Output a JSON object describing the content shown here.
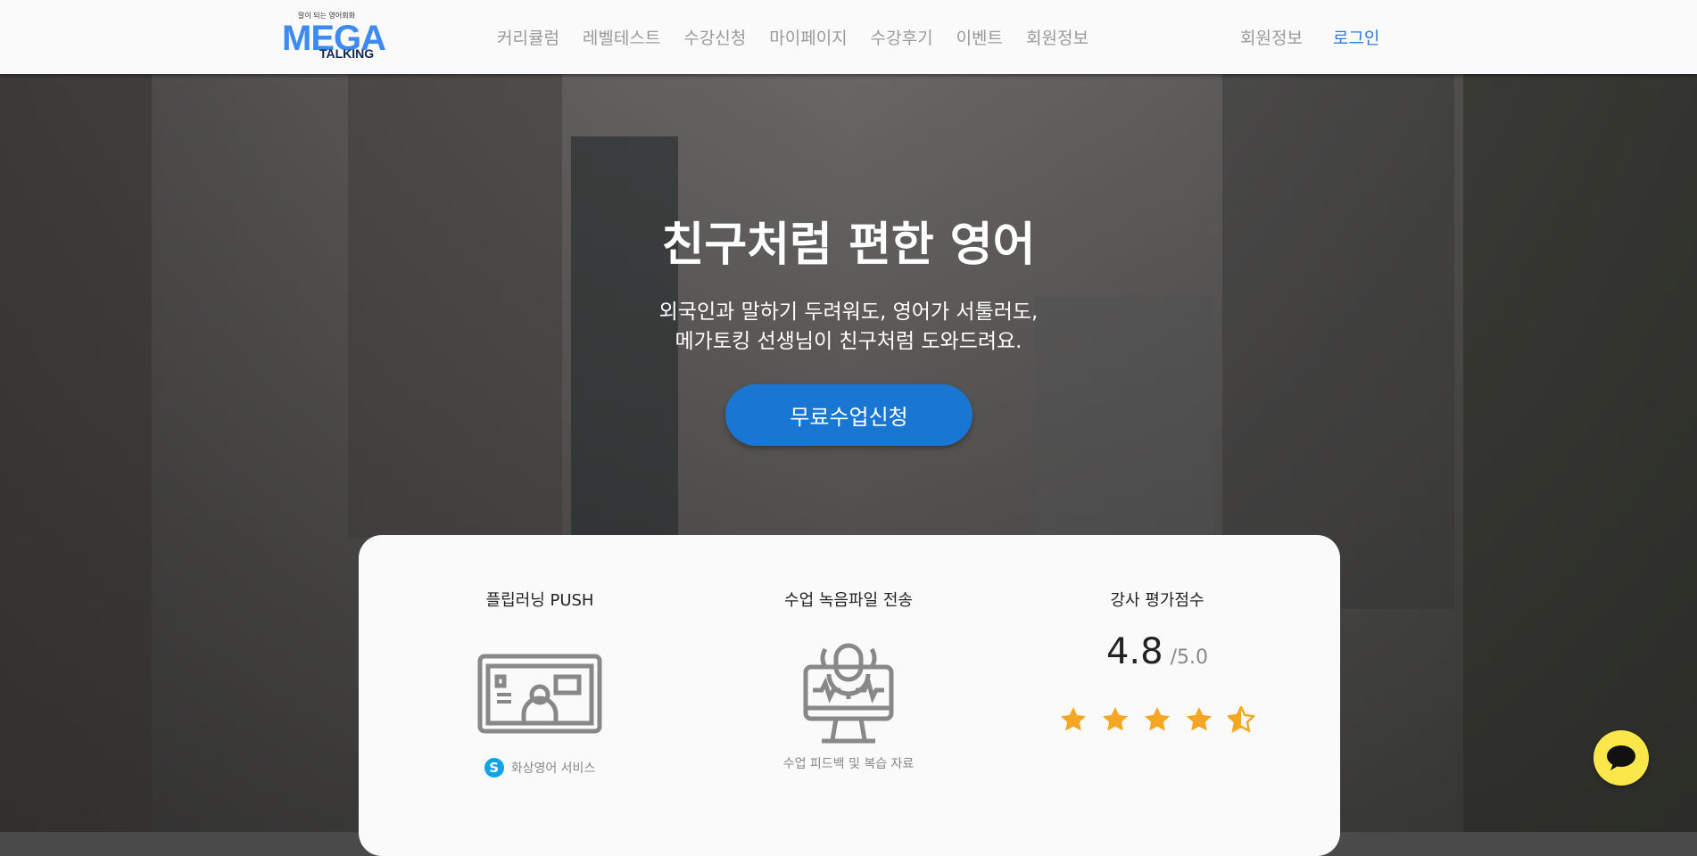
{
  "header": {
    "logo_tagline": "말이 되는 영어회화",
    "logo_text_top": "MEGA",
    "logo_text_bottom": "TALKING",
    "nav": [
      "커리큘럼",
      "레벨테스트",
      "수강신청",
      "마이페이지",
      "수강후기",
      "이벤트",
      "회원정보"
    ],
    "member_label": "회원정보",
    "login_label": "로그인"
  },
  "hero": {
    "title": "친구처럼 편한 영어",
    "subtitle_line1": "외국인과 말하기 두려워도, 영어가 서툴러도,",
    "subtitle_line2": "메가토킹 선생님이 친구처럼 도와드려요.",
    "cta_label": "무료수업신청"
  },
  "features": {
    "push": {
      "title": "플립러닝 PUSH",
      "caption": "화상영어 서비스",
      "icon": "video-call-icon",
      "caption_icon": "skype-icon"
    },
    "recording": {
      "title": "수업 녹음파일 전송",
      "caption": "수업 피드백 및 복습 자료",
      "icon": "microphone-monitor-icon"
    },
    "rating": {
      "title": "강사 평가점수",
      "score": "4.8",
      "max": "/5.0",
      "stars": 4.5
    }
  },
  "colors": {
    "accent": "#1a76d3",
    "star": "#f5a623",
    "chat": "#fbe74a"
  }
}
